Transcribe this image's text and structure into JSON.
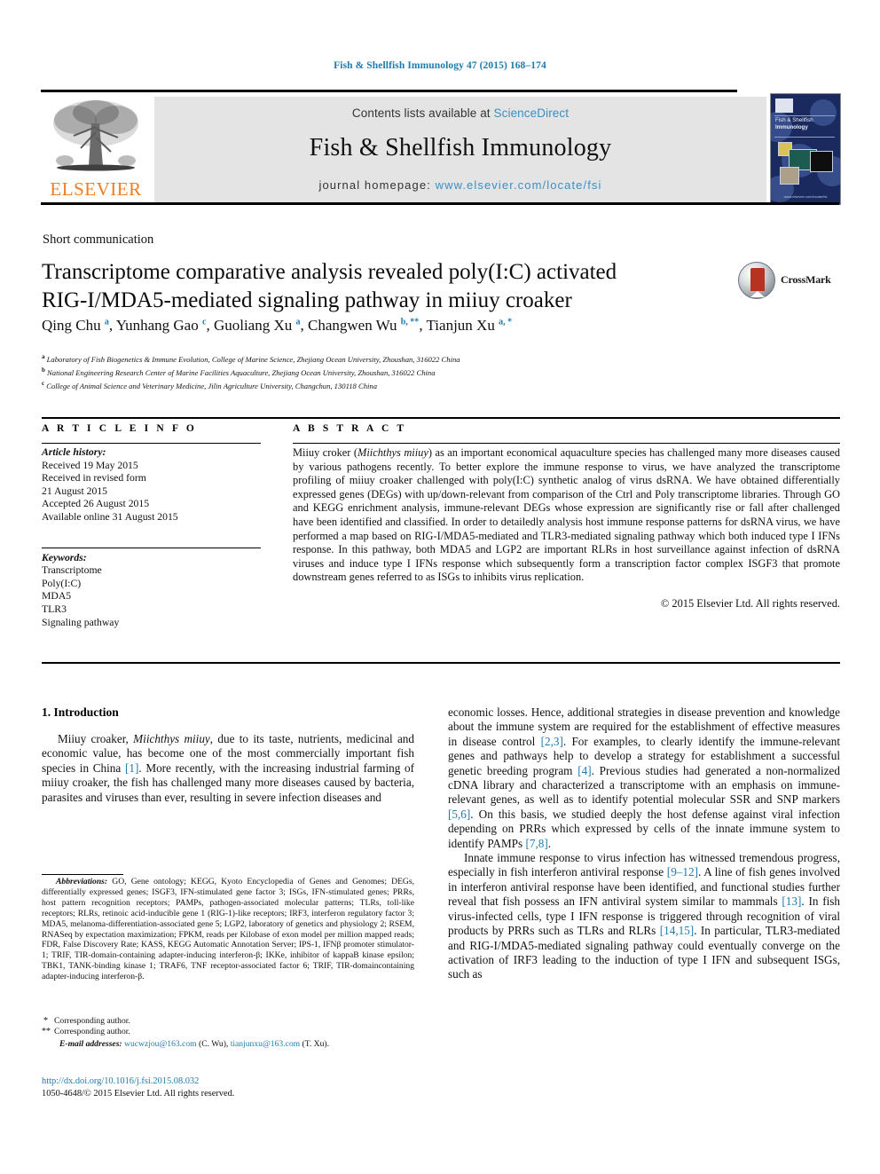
{
  "running_head": "Fish & Shellfish Immunology 47 (2015) 168–174",
  "masthead": {
    "contents_prefix": "Contents lists available at ",
    "sciencedirect": "ScienceDirect",
    "journal_title": "Fish & Shellfish Immunology",
    "homepage_prefix": "journal homepage: ",
    "homepage_url": "www.elsevier.com/locate/fsi",
    "publisher_wordmark": "ELSEVIER",
    "cover_title_line1": "Fish & Shellfish",
    "cover_title_line2": "Immunology",
    "cover_footer": "www.elsevier.com/locate/fsi"
  },
  "article": {
    "type": "Short communication",
    "title_line1": "Transcriptome comparative analysis revealed poly(I:C) activated",
    "title_line2": "RIG-I/MDA5-mediated signaling pathway in miiuy croaker",
    "crossmark_label": "CrossMark",
    "authors": [
      {
        "name": "Qing Chu",
        "marks": "a",
        "sep": ", "
      },
      {
        "name": "Yunhang Gao",
        "marks": "c",
        "sep": ", "
      },
      {
        "name": "Guoliang Xu",
        "marks": "a",
        "sep": ", "
      },
      {
        "name": "Changwen Wu",
        "marks": "b, **",
        "sep": ", "
      },
      {
        "name": "Tianjun Xu",
        "marks": "a, *",
        "sep": ""
      }
    ],
    "affiliations": [
      {
        "mark": "a",
        "text": "Laboratory of Fish Biogenetics & Immune Evolution, College of Marine Science, Zhejiang Ocean University, Zhoushan, 316022 China"
      },
      {
        "mark": "b",
        "text": "National Engineering Research Center of Marine Facilities Aquaculture, Zhejiang Ocean University, Zhoushan, 316022 China"
      },
      {
        "mark": "c",
        "text": "College of Animal Science and Veterinary Medicine, Jilin Agriculture University, Changchun, 130118 China"
      }
    ]
  },
  "article_info": {
    "heading": "A R T I C L E   I N F O",
    "history_label": "Article history:",
    "history": [
      "Received 19 May 2015",
      "Received in revised form",
      "21 August 2015",
      "Accepted 26 August 2015",
      "Available online 31 August 2015"
    ],
    "keywords_label": "Keywords:",
    "keywords": [
      "Transcriptome",
      "Poly(I:C)",
      "MDA5",
      "TLR3",
      "Signaling pathway"
    ]
  },
  "abstract": {
    "heading": "A B S T R A C T",
    "lead": "Miiuy croker (",
    "species": "Miichthys miiuy",
    "body": ") as an important economical aquaculture species has challenged many more diseases caused by various pathogens recently. To better explore the immune response to virus, we have analyzed the transcriptome profiling of miiuy croaker challenged with poly(I:C) synthetic analog of virus dsRNA. We have obtained differentially expressed genes (DEGs) with up/down-relevant from comparison of the Ctrl and Poly transcriptome libraries. Through GO and KEGG enrichment analysis, immune-relevant DEGs whose expression are significantly rise or fall after challenged have been identified and classified. In order to detailedly analysis host immune response patterns for dsRNA virus, we have performed a map based on RIG-I/MDA5-mediated and TLR3-mediated signaling pathway which both induced type I IFNs response. In this pathway, both MDA5 and LGP2 are important RLRs in host surveillance against infection of dsRNA viruses and induce type I IFNs response which subsequently form a transcription factor complex ISGF3 that promote downstream genes referred to as ISGs to inhibits virus replication.",
    "copyright": "© 2015 Elsevier Ltd. All rights reserved."
  },
  "body": {
    "section_number_title": "1. Introduction",
    "left_para1_a": "Miiuy croaker, ",
    "left_para1_species": "Miichthys miiuy",
    "left_para1_b": ", due to its taste, nutrients, medicinal and economic value, has become one of the most commercially important fish species in China ",
    "left_para1_ref1": "[1]",
    "left_para1_c": ". More recently, with the increasing industrial farming of miiuy croaker, the fish has challenged many more diseases caused by bacteria, parasites and viruses than ever, resulting in severe infection diseases and",
    "right_para1_a": "economic losses. Hence, additional strategies in disease prevention and knowledge about the immune system are required for the establishment of effective measures in disease control ",
    "right_para1_ref1": "[2,3]",
    "right_para1_b": ". For examples, to clearly identify the immune-relevant genes and pathways help to develop a strategy for establishment a successful genetic breeding program ",
    "right_para1_ref2": "[4]",
    "right_para1_c": ". Previous studies had generated a non-normalized cDNA library and characterized a transcriptome with an emphasis on immune-relevant genes, as well as to identify potential molecular SSR and SNP markers ",
    "right_para1_ref3": "[5,6]",
    "right_para1_d": ". On this basis, we studied deeply the host defense against viral infection depending on PRRs which expressed by cells of the innate immune system to identify PAMPs ",
    "right_para1_ref4": "[7,8]",
    "right_para1_e": ".",
    "right_para2_a": "Innate immune response to virus infection has witnessed tremendous progress, especially in fish interferon antiviral response ",
    "right_para2_ref1": "[9–12]",
    "right_para2_b": ". A line of fish genes involved in interferon antiviral response have been identified, and functional studies further reveal that fish possess an IFN antiviral system similar to mammals ",
    "right_para2_ref2": "[13]",
    "right_para2_c": ". In fish virus-infected cells, type I IFN response is triggered through recognition of viral products by PRRs such as TLRs and RLRs ",
    "right_para2_ref3": "[14,15]",
    "right_para2_d": ". In particular, TLR3-mediated and RIG-I/MDA5-mediated signaling pathway could eventually converge on the activation of IRF3 leading to the induction of type I IFN and subsequent ISGs, such as"
  },
  "footnotes": {
    "abbreviations_label": "Abbreviations:",
    "abbreviations_text": " GO, Gene ontology; KEGG, Kyoto Encyclopedia of Genes and Genomes; DEGs, differentially expressed genes; ISGF3, IFN-stimulated gene factor 3; ISGs, IFN-stimulated genes; PRRs, host pattern recognition receptors; PAMPs, pathogen-associated molecular patterns; TLRs, toll-like receptors; RLRs, retinoic acid-inducible gene 1 (RIG-1)-like receptors; IRF3, interferon regulatory factor 3; MDA5, melanoma-differentiation-associated gene 5; LGP2, laboratory of genetics and physiology 2; RSEM, RNASeq by expectation maximization; FPKM, reads per Kilobase of exon model per million mapped reads; FDR, False Discovery Rate; KASS, KEGG Automatic Annotation Server; IPS-1, IFNβ promoter stimulator-1; TRIF, TIR-domain-containing adapter-inducing interferon-β; IKKe, inhibitor of kappaB kinase epsilon; TBK1, TANK-binding kinase 1; TRAF6, TNF receptor-associated factor 6; TRIF, TIR-domaincontaining adapter-inducing interferon-β.",
    "corresponding_single_mark": "*",
    "corresponding_single": "Corresponding author.",
    "corresponding_double_mark": "**",
    "corresponding_double": "Corresponding author.",
    "email_label": "E-mail addresses:",
    "email1": "wucwzjou@163.com",
    "email1_owner": "(C. Wu)",
    "email2": "tianjunxu@163.com",
    "email2_owner": "(T. Xu)",
    "doi": "http://dx.doi.org/10.1016/j.fsi.2015.08.032",
    "issn_line": "1050-4648/© 2015 Elsevier Ltd. All rights reserved."
  },
  "colors": {
    "link_blue": "#1d7bae",
    "sciencedirect_blue": "#3a8fc4",
    "elsevier_orange": "#ef7d22",
    "masthead_gray": "#e4e4e4"
  }
}
